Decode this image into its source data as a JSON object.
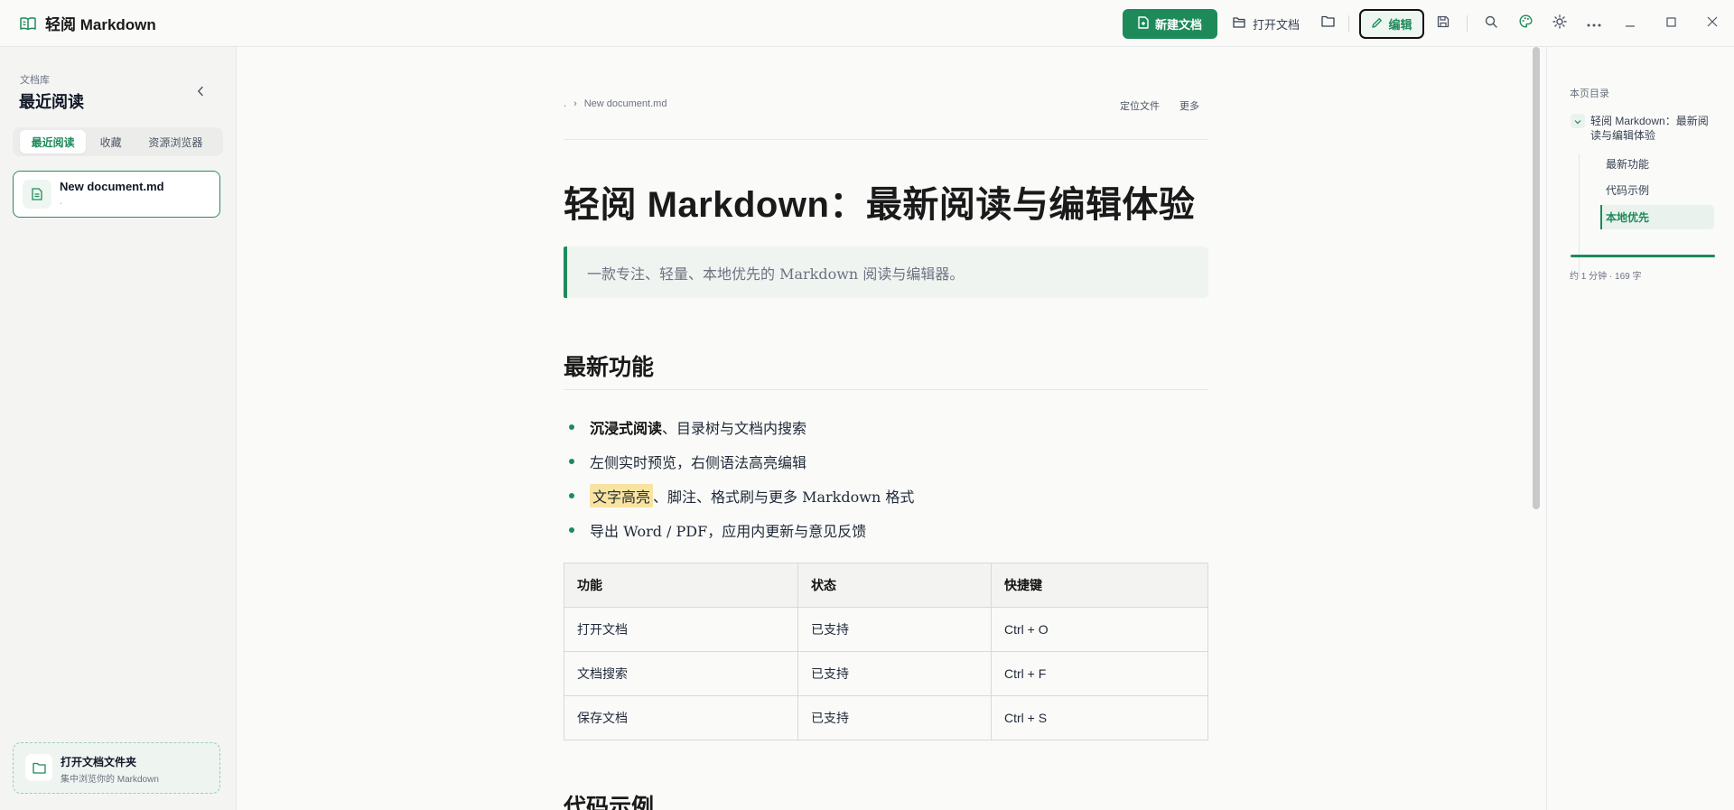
{
  "app": {
    "title": "轻阅 Markdown"
  },
  "toolbar": {
    "new_doc_label": "新建文档",
    "open_doc_label": "打开文档",
    "edit_label": "编辑"
  },
  "sidebar": {
    "eyebrow": "文档库",
    "title": "最近阅读",
    "tabs": [
      {
        "label": "最近阅读",
        "active": true
      },
      {
        "label": "收藏",
        "active": false
      },
      {
        "label": "资源浏览器",
        "active": false
      }
    ],
    "recent_docs": [
      {
        "name": "New document.md",
        "path": "."
      }
    ],
    "open_folder": {
      "title": "打开文档文件夹",
      "subtitle": "集中浏览你的 Markdown"
    }
  },
  "document": {
    "breadcrumb": {
      "root": ".",
      "separator": "›",
      "file": "New document.md"
    },
    "actions": {
      "locate_label": "定位文件",
      "more_label": "更多"
    },
    "h1": "轻阅 Markdown：最新阅读与编辑体验",
    "blockquote": "一款专注、轻量、本地优先的 Markdown 阅读与编辑器。",
    "section_features_title": "最新功能",
    "features": {
      "item1_bold": "沉浸式阅读",
      "item1_rest": "、目录树与文档内搜索",
      "item2": "左侧实时预览，右侧语法高亮编辑",
      "item3_mark": "文字高亮",
      "item3_rest": "、脚注、格式刷与更多 Markdown 格式",
      "item4": "导出 Word / PDF，应用内更新与意见反馈"
    },
    "table": {
      "headers": [
        "功能",
        "状态",
        "快捷键"
      ],
      "rows": [
        [
          "打开文档",
          "已支持",
          "Ctrl + O"
        ],
        [
          "文档搜索",
          "已支持",
          "Ctrl + F"
        ],
        [
          "保存文档",
          "已支持",
          "Ctrl + S"
        ]
      ]
    },
    "section_code_title": "代码示例"
  },
  "outline": {
    "eyebrow": "本页目录",
    "root": "轻阅 Markdown：最新阅读与编辑体验",
    "items": [
      "最新功能",
      "代码示例",
      "本地优先"
    ],
    "active_index": 2,
    "meta": "约 1 分钟 · 169 字"
  },
  "colors": {
    "accent": "#1e8a5a",
    "highlight": "#f8e3a0"
  },
  "icons": {
    "brand": "book-open-icon",
    "new_doc": "file-plus-icon",
    "open_doc": "folder-open-icon",
    "folder": "folder-icon",
    "edit": "pencil-icon",
    "save": "save-icon",
    "search": "search-icon",
    "theme": "palette-icon",
    "brightness": "sun-icon",
    "more": "more-horizontal-icon",
    "minimize": "minimize-icon",
    "maximize": "maximize-icon",
    "close": "close-icon"
  }
}
